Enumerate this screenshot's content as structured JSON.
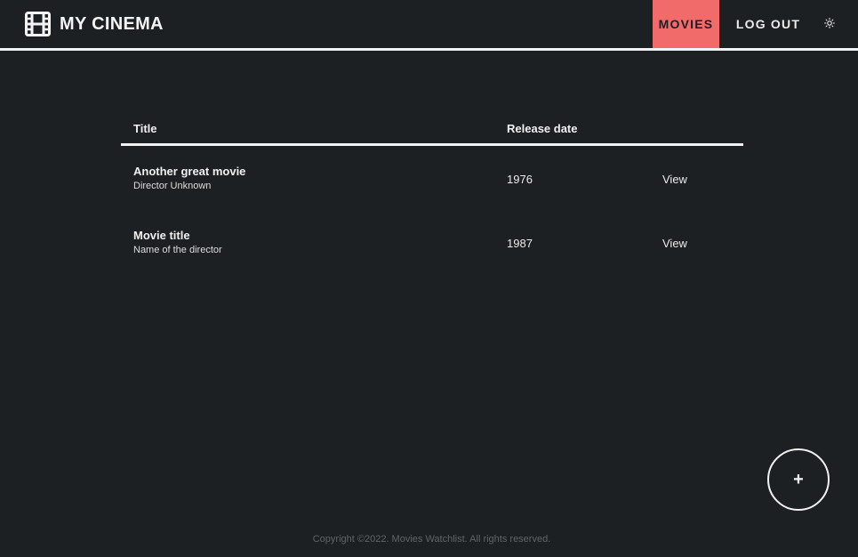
{
  "header": {
    "brand_icon": "film-icon",
    "brand_name": "MY CINEMA",
    "nav": {
      "movies": "MOVIES",
      "logout": "LOG OUT",
      "theme_icon": "sun-icon"
    },
    "accent_color": "#f26b6b"
  },
  "table": {
    "columns": {
      "title": "Title",
      "release_date": "Release date"
    },
    "rows": [
      {
        "title": "Another great movie",
        "director": "Director Unknown",
        "year": "1976",
        "action": "View"
      },
      {
        "title": "Movie title",
        "director": "Name of the director",
        "year": "1987",
        "action": "View"
      }
    ]
  },
  "fab": {
    "label": "+"
  },
  "footer": {
    "text": "Copyright ©2022. Movies Watchlist. All rights reserved."
  }
}
